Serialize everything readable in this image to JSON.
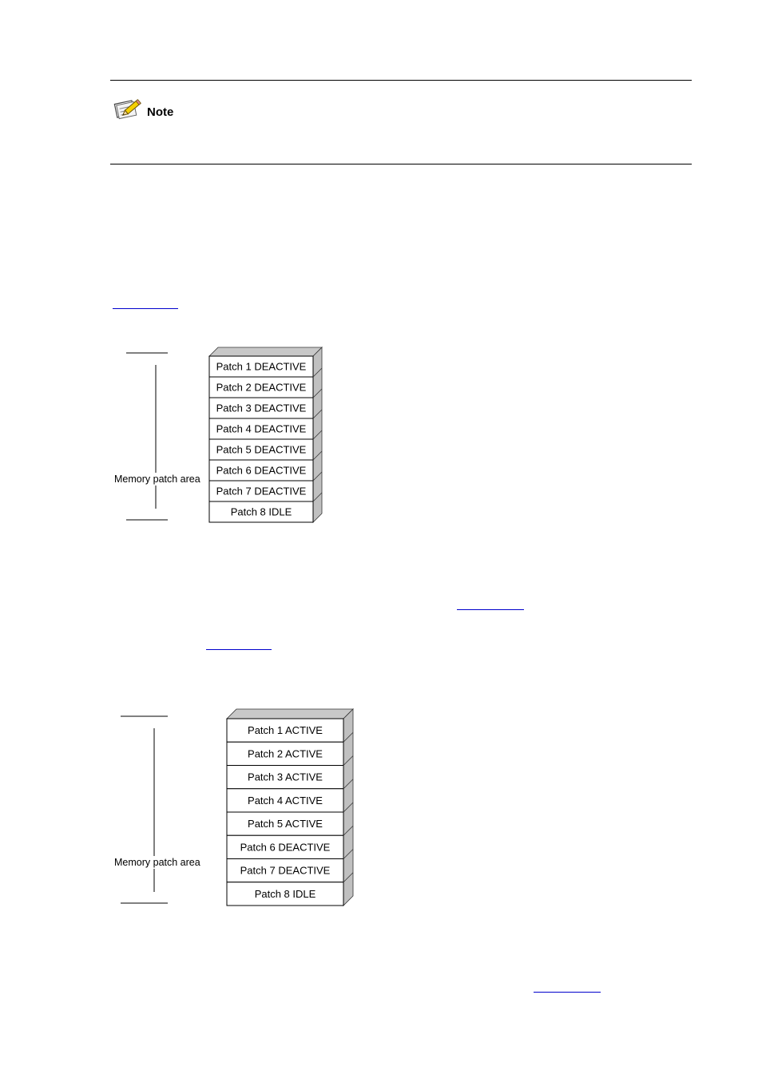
{
  "note": {
    "icon": "note-pencil-icon",
    "label": "Note"
  },
  "links": [
    {
      "name": "link-1",
      "text": ""
    },
    {
      "name": "link-2",
      "text": ""
    },
    {
      "name": "link-3",
      "text": ""
    },
    {
      "name": "link-4",
      "text": ""
    }
  ],
  "figures": [
    {
      "area_label": "Memory patch area",
      "patches": [
        "Patch 1 DEACTIVE",
        "Patch 2 DEACTIVE",
        "Patch 3 DEACTIVE",
        "Patch 4 DEACTIVE",
        "Patch 5 DEACTIVE",
        "Patch 6 DEACTIVE",
        "Patch 7 DEACTIVE",
        "Patch 8 IDLE"
      ]
    },
    {
      "area_label": "Memory patch area",
      "patches": [
        "Patch 1 ACTIVE",
        "Patch 2 ACTIVE",
        "Patch 3 ACTIVE",
        "Patch 4 ACTIVE",
        "Patch 5 ACTIVE",
        "Patch 6 DEACTIVE",
        "Patch 7 DEACTIVE",
        "Patch 8 IDLE"
      ]
    }
  ],
  "colors": {
    "link": "#0000cc",
    "box_side": "#c0c0c0",
    "box_top": "#c8c8c8"
  }
}
